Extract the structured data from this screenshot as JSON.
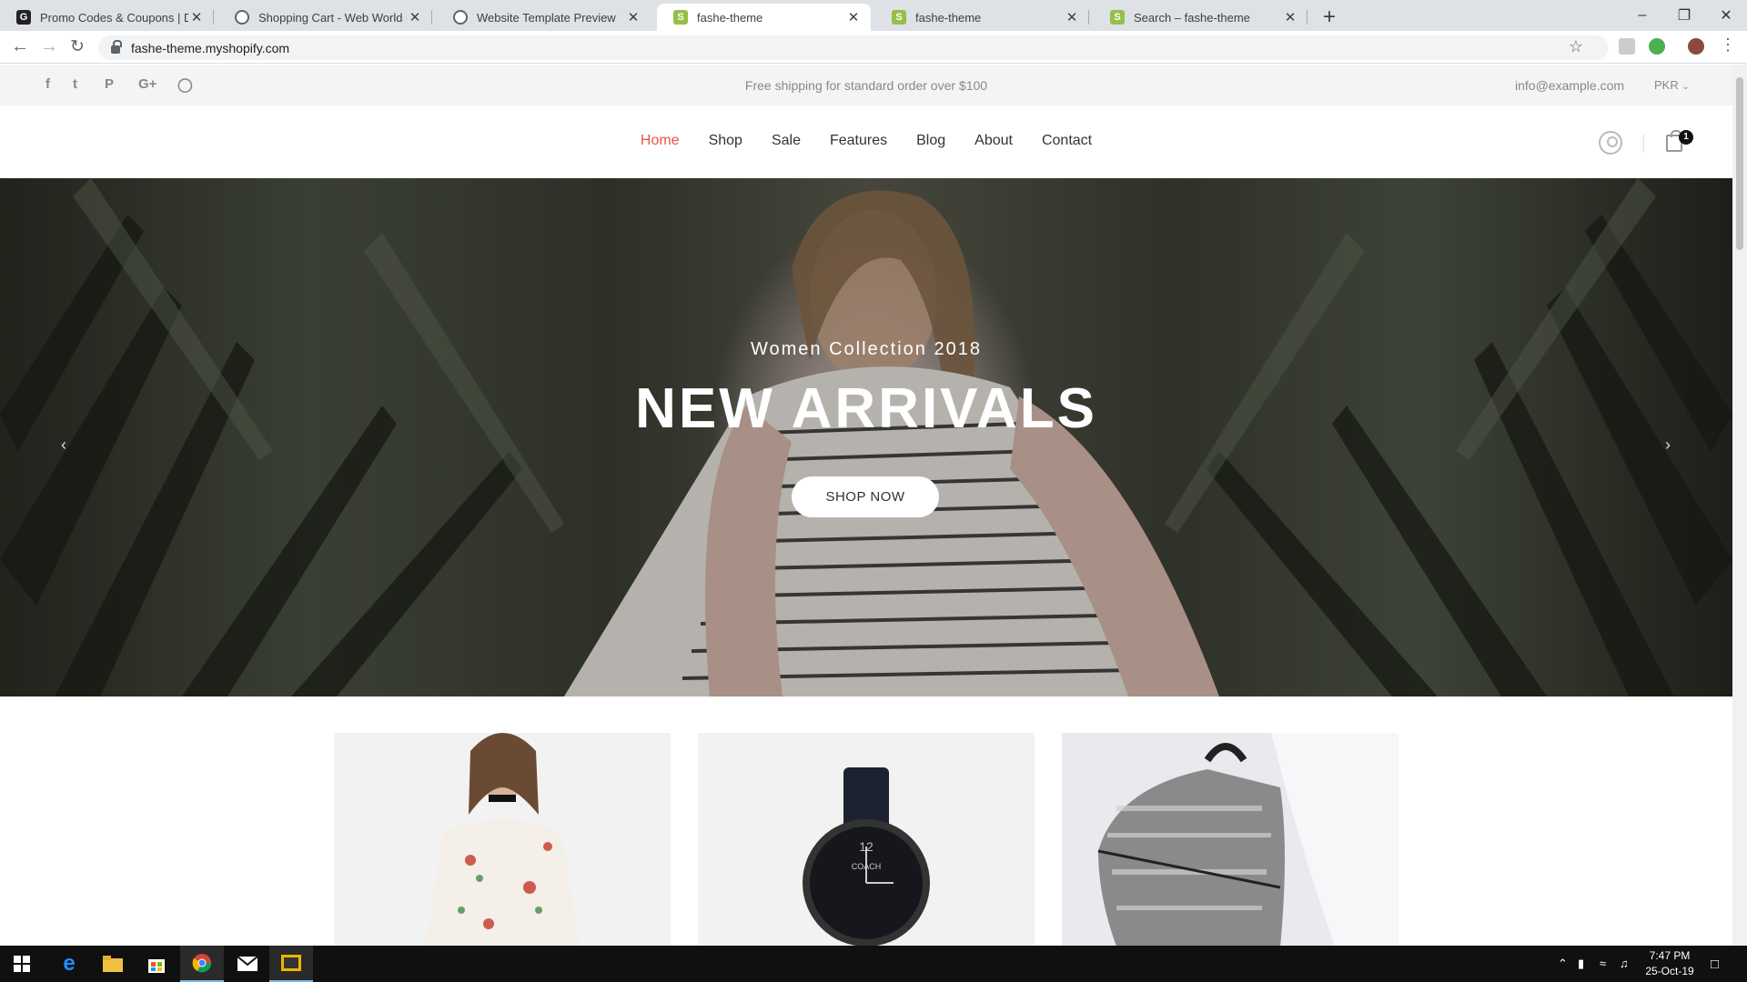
{
  "browser": {
    "tabs": [
      {
        "title": "Promo Codes & Coupons | Disco",
        "favicon": "g-icon"
      },
      {
        "title": "Shopping Cart - Web World Cent",
        "favicon": "globe-icon"
      },
      {
        "title": "Website Template Preview",
        "favicon": "globe-icon"
      },
      {
        "title": "fashe-theme",
        "favicon": "shopify-icon",
        "active": true
      },
      {
        "title": "fashe-theme",
        "favicon": "shopify-icon"
      },
      {
        "title": "Search – fashe-theme",
        "favicon": "shopify-icon"
      }
    ],
    "url": "fashe-theme.myshopify.com"
  },
  "topbar": {
    "social_icons": [
      "facebook-icon",
      "twitter-icon",
      "pinterest-icon",
      "google-plus-icon",
      "instagram-icon"
    ],
    "shipping_text": "Free shipping for standard order over $100",
    "email": "info@example.com",
    "currency": "PKR"
  },
  "nav": {
    "items": [
      "Home",
      "Shop",
      "Sale",
      "Features",
      "Blog",
      "About",
      "Contact"
    ],
    "active": "Home",
    "cart_count": "1"
  },
  "hero": {
    "subtitle": "Women Collection 2018",
    "title": "NEW ARRIVALS",
    "button": "SHOP NOW"
  },
  "products": [
    "dress-image",
    "watch-image",
    "backpack-image"
  ],
  "taskbar": {
    "time": "7:47 PM",
    "date": "25-Oct-19"
  },
  "colors": {
    "accent": "#e65540",
    "topbar_bg": "#f4f4f4",
    "taskbar_bg": "#101010"
  }
}
